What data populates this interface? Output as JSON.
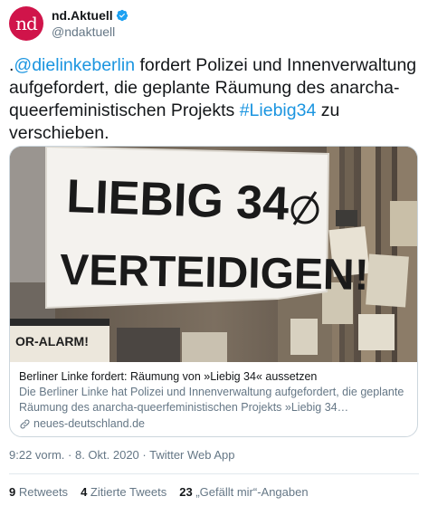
{
  "author": {
    "avatar_text": "nd",
    "display_name": "nd.Aktuell",
    "handle": "@ndaktuell",
    "verified_icon": "verified-badge-icon"
  },
  "tweet": {
    "prefix": ".",
    "mention": "@dielinkeberlin",
    "text_middle": " fordert Polizei und Innenverwaltung aufgefordert, die geplante Räumung des anarcha-queerfeministischen Projekts ",
    "hashtag": "#Liebig34",
    "text_end": " zu verschieben."
  },
  "card": {
    "image": {
      "banner_line1": "LIEBIG 34",
      "banner_line2": "VERTEIDIGEN!",
      "poster_text": "OR-ALARM!"
    },
    "title": "Berliner Linke fordert: Räumung von »Liebig 34« aussetzen",
    "description": "Die Berliner Linke hat Polizei und Innenverwaltung aufgefordert, die geplante Räumung des anarcha-queerfeministischen Projekts »Liebig 34…",
    "domain": "neues-deutschland.de",
    "link_icon": "link-icon"
  },
  "meta": {
    "timestamp": "9:22 vorm. · 8. Okt. 2020 · Twitter Web App"
  },
  "stats": {
    "retweets_count": "9",
    "retweets_label": "Retweets",
    "quotes_count": "4",
    "quotes_label": "Zitierte Tweets",
    "likes_count": "23",
    "likes_label": "„Gefällt mir“-Angaben"
  },
  "colors": {
    "accent": "#1b95e0",
    "brand": "#d0144a",
    "muted": "#657786"
  }
}
